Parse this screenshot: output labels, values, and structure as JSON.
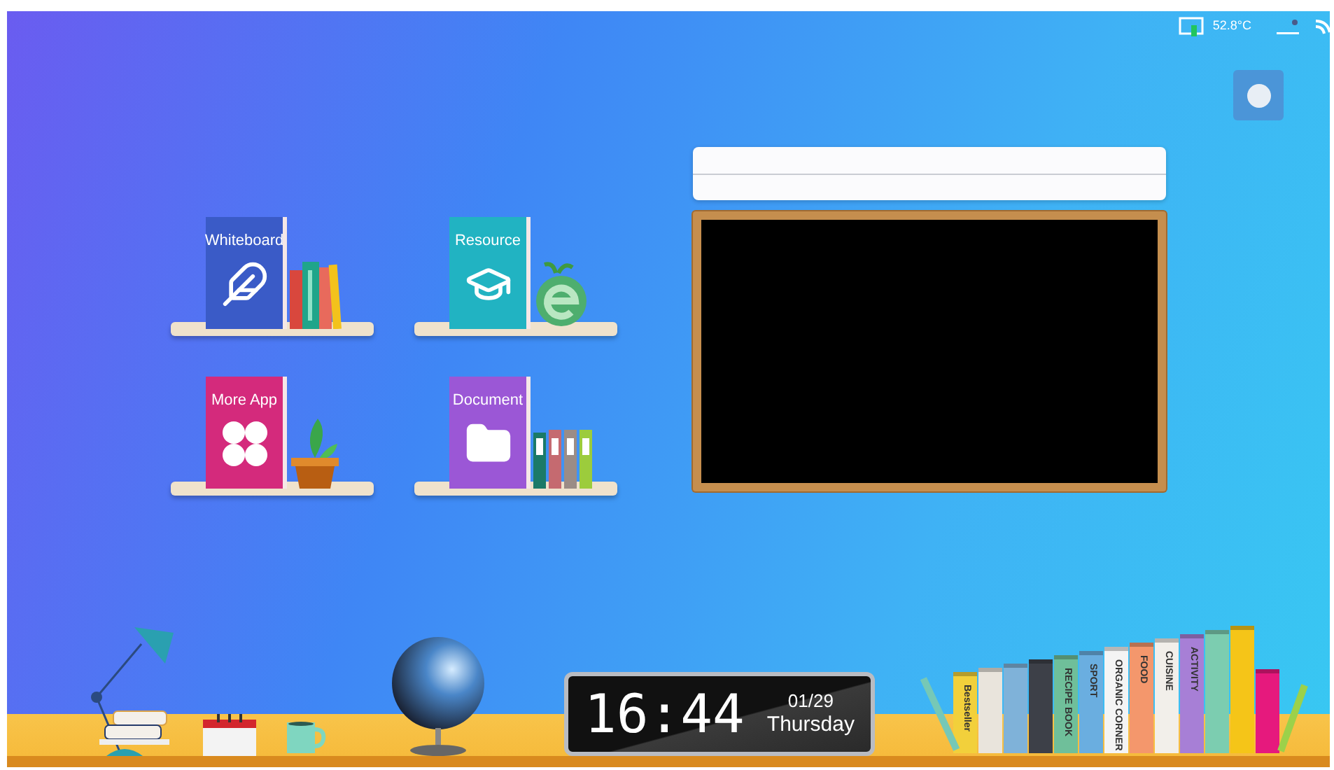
{
  "status_bar": {
    "temperature": "52.8°C"
  },
  "apps": [
    {
      "kind": "whiteboard",
      "label": "Whiteboard"
    },
    {
      "kind": "resource",
      "label": "Resource"
    },
    {
      "kind": "more",
      "label": "More App"
    },
    {
      "kind": "document",
      "label": "Document"
    }
  ],
  "clock": {
    "time": "16:44",
    "date": "01/29",
    "weekday": "Thursday"
  },
  "bookshelf": [
    {
      "label": "Bestseller",
      "color": "#f2d03b"
    },
    {
      "color": "#e9e4dc"
    },
    {
      "color": "#7fb2d9"
    },
    {
      "color": "#3d4048"
    },
    {
      "label": "RECIPE BOOK",
      "color": "#6fbf9a"
    },
    {
      "label": "SPORT",
      "color": "#6aaee0"
    },
    {
      "label": "ORGANIC CORNER",
      "color": "#f4f4f4"
    },
    {
      "label": "FOOD",
      "color": "#f4976c"
    },
    {
      "label": "CUISINE",
      "color": "#f2efea"
    },
    {
      "label": "ACTIVITY",
      "color": "#a77fd6"
    },
    {
      "color": "#7ccdb0"
    },
    {
      "color": "#f5c518"
    },
    {
      "color": "#e6197d"
    }
  ]
}
